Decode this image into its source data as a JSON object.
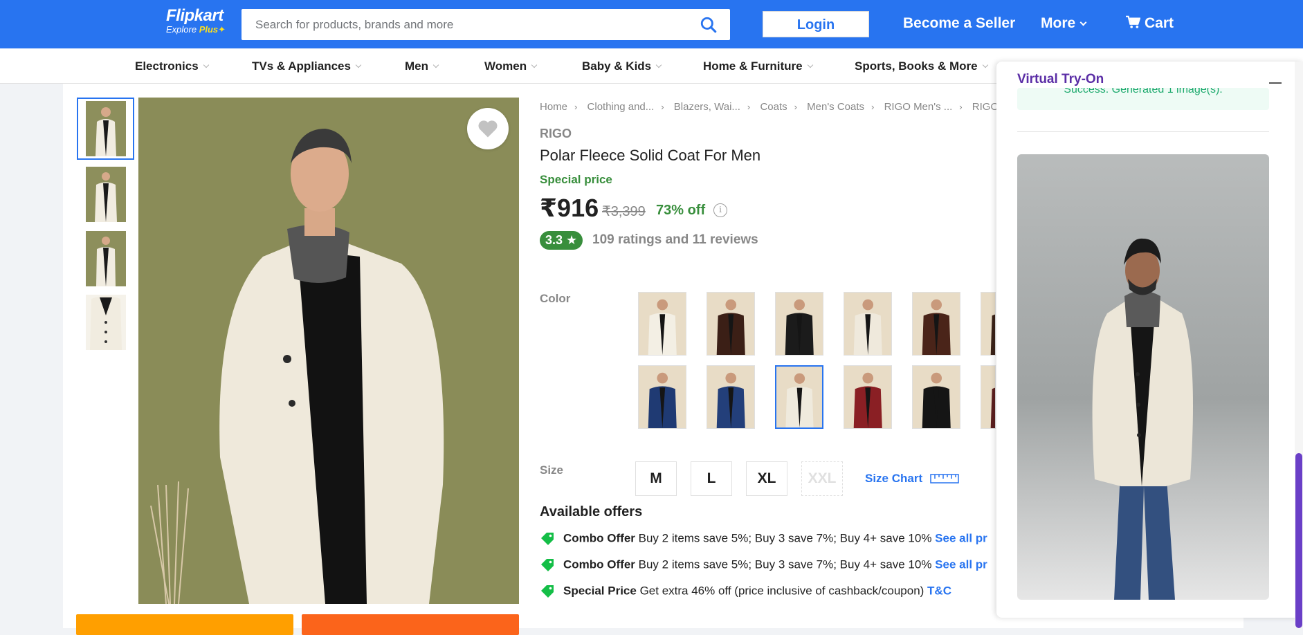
{
  "header": {
    "logo_main": "Flipkart",
    "logo_sub": "Explore",
    "logo_plus": "Plus",
    "search_placeholder": "Search for products, brands and more",
    "login_label": "Login",
    "seller_label": "Become a Seller",
    "more_label": "More",
    "cart_label": "Cart"
  },
  "categories": [
    "Electronics",
    "TVs & Appliances",
    "Men",
    "Women",
    "Baby & Kids",
    "Home & Furniture",
    "Sports, Books & More"
  ],
  "breadcrumbs": [
    "Home",
    "Clothing and...",
    "Blazers, Wai...",
    "Coats",
    "Men's Coats",
    "RIGO Men's ...",
    "RIGO P"
  ],
  "product": {
    "brand": "RIGO",
    "title": "Polar Fleece Solid Coat For Men",
    "special_label": "Special price",
    "price": "₹916",
    "mrp": "₹3,399",
    "discount": "73% off",
    "rating": "3.3",
    "rating_star": "★",
    "reviews": "109 ratings and 11 reviews"
  },
  "labels": {
    "color": "Color",
    "size": "Size",
    "size_chart": "Size Chart",
    "offers_title": "Available offers"
  },
  "colors": {
    "accent": "#2874f0",
    "green": "#388e3c",
    "swatches": [
      "#f3efe4",
      "#3b1f16",
      "#1b1b1b",
      "#efe9dc",
      "#4a2419",
      "#3a2218",
      "#1f3a73",
      "#233f7a",
      "#efeadd",
      "#8a1f24",
      "#151515",
      "#5b1f1f"
    ]
  },
  "sizes": [
    "M",
    "L",
    "XL",
    "XXL"
  ],
  "offers": [
    {
      "type": "Combo Offer",
      "text": "Buy 2 items save 5%; Buy 3 save 7%; Buy 4+ save 10%",
      "link": "See all pr"
    },
    {
      "type": "Combo Offer",
      "text": "Buy 2 items save 5%; Buy 3 save 7%; Buy 4+ save 10%",
      "link": "See all pr"
    },
    {
      "type": "Special Price",
      "text": "Get extra 46% off (price inclusive of cashback/coupon)",
      "link": "T&C"
    }
  ],
  "tryon": {
    "title": "Virtual Try-On",
    "status": "Success. Generated 1 image(s)."
  }
}
